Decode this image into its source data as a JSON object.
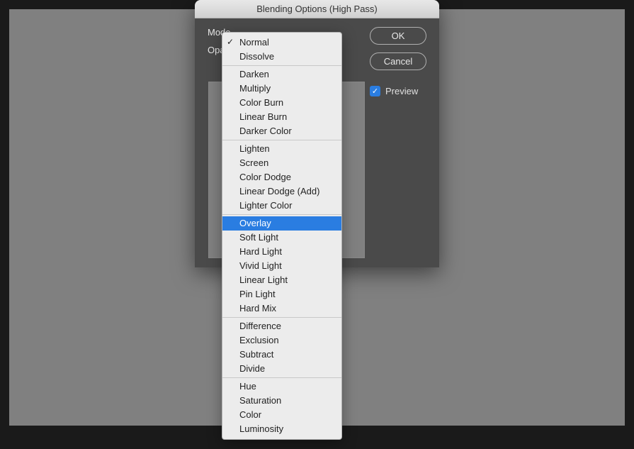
{
  "dialog": {
    "title": "Blending Options (High Pass)",
    "mode_label": "Mode",
    "opacity_label": "Opac",
    "ok_label": "OK",
    "cancel_label": "Cancel",
    "preview_label": "Preview",
    "preview_checked": true
  },
  "blend_modes": {
    "current": "Normal",
    "highlighted": "Overlay",
    "groups": [
      [
        "Normal",
        "Dissolve"
      ],
      [
        "Darken",
        "Multiply",
        "Color Burn",
        "Linear Burn",
        "Darker Color"
      ],
      [
        "Lighten",
        "Screen",
        "Color Dodge",
        "Linear Dodge (Add)",
        "Lighter Color"
      ],
      [
        "Overlay",
        "Soft Light",
        "Hard Light",
        "Vivid Light",
        "Linear Light",
        "Pin Light",
        "Hard Mix"
      ],
      [
        "Difference",
        "Exclusion",
        "Subtract",
        "Divide"
      ],
      [
        "Hue",
        "Saturation",
        "Color",
        "Luminosity"
      ]
    ]
  }
}
